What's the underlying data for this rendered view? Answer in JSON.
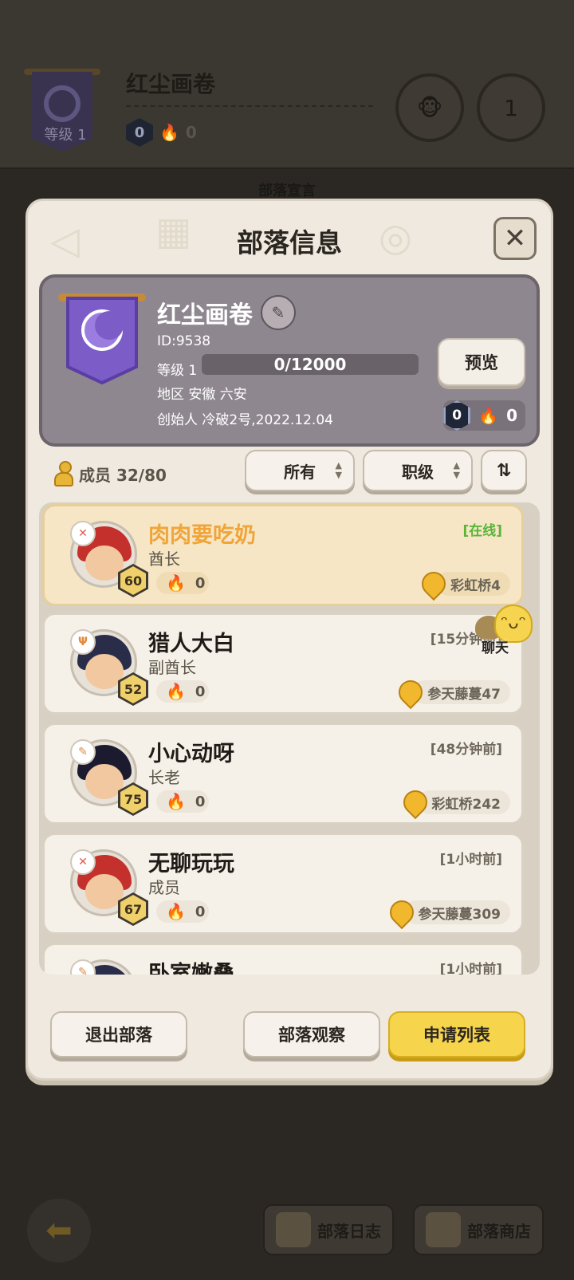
{
  "background": {
    "tribe_name": "红尘画卷",
    "level_label": "等级 1",
    "shield_count": "0",
    "fire_count": "0",
    "rank_badge": "1",
    "section_title": "部落宣言",
    "tabs": [
      {
        "label": "部落日志"
      },
      {
        "label": "部落商店"
      }
    ]
  },
  "modal": {
    "title": "部落信息",
    "tribe": {
      "name": "红尘画卷",
      "id": "ID:9538",
      "level": "等级 1",
      "progress_text": "0/12000",
      "progress_fraction": 0,
      "region": "地区 安徽 六安",
      "founder": "创始人 冷破2号,2022.12.04",
      "preview_label": "预览",
      "shield_count": "0",
      "fire_count": "0"
    },
    "filters": {
      "members": "成员 32/80",
      "all": "所有",
      "rank": "职级"
    },
    "members": [
      {
        "name": "肉肉要吃奶",
        "role": "酋长",
        "level": "60",
        "fire": "0",
        "status": "[在线]",
        "location": "彩虹桥4",
        "hair": "#c4302b"
      },
      {
        "name": "猎人大白",
        "role": "副酋长",
        "level": "52",
        "fire": "0",
        "status": "[15分钟前]",
        "location": "参天藤蔓47",
        "hair": "#2a2d4a"
      },
      {
        "name": "小心动呀",
        "role": "长老",
        "level": "75",
        "fire": "0",
        "status": "[48分钟前]",
        "location": "彩虹桥242",
        "hair": "#1c1a2e"
      },
      {
        "name": "无聊玩玩",
        "role": "成员",
        "level": "67",
        "fire": "0",
        "status": "[1小时前]",
        "location": "参天藤蔓309",
        "hair": "#c4302b"
      },
      {
        "name": "卧室嫩叠",
        "role": "",
        "level": "",
        "fire": "",
        "status": "[1小时前]",
        "location": "",
        "hair": "#2a2d4a"
      }
    ],
    "chat_label": "聊天",
    "buttons": {
      "leave": "退出部落",
      "observe": "部落观察",
      "applications": "申请列表"
    }
  }
}
